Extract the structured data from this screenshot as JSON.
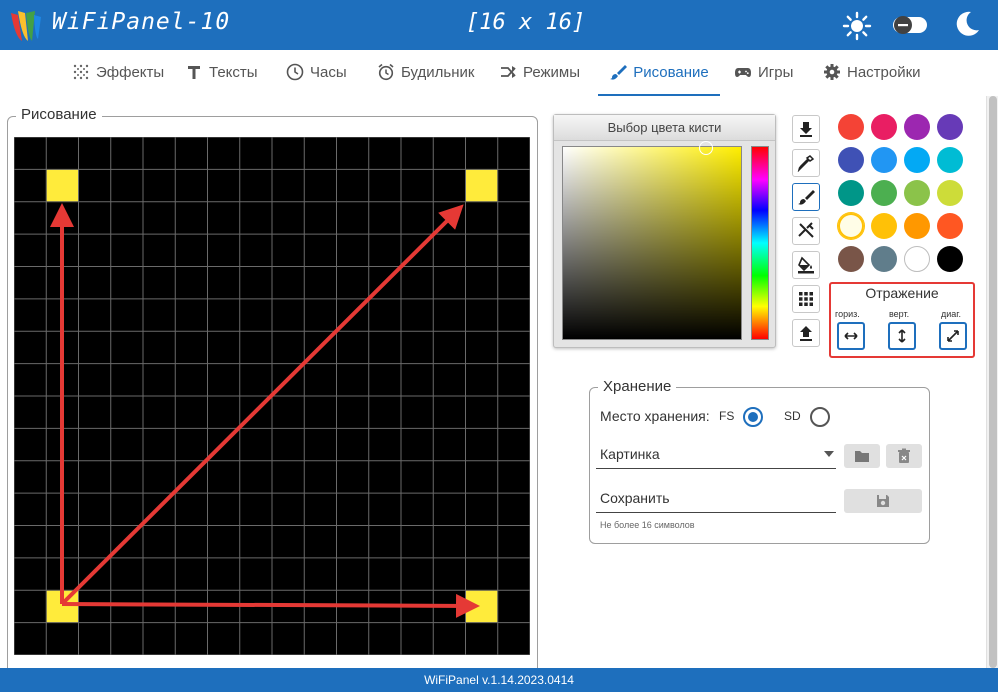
{
  "header": {
    "app_title": "WiFiPanel-10",
    "matrix_size": "[16 x 16]"
  },
  "tabs": [
    {
      "label": "Эффекты",
      "icon": "dots-grid-icon"
    },
    {
      "label": "Тексты",
      "icon": "text-icon"
    },
    {
      "label": "Часы",
      "icon": "clock-icon"
    },
    {
      "label": "Будильник",
      "icon": "alarm-icon"
    },
    {
      "label": "Режимы",
      "icon": "modes-icon"
    },
    {
      "label": "Рисование",
      "icon": "brush-icon",
      "active": true
    },
    {
      "label": "Игры",
      "icon": "gamepad-icon"
    },
    {
      "label": "Настройки",
      "icon": "gear-icon"
    }
  ],
  "drawing": {
    "legend": "Рисование",
    "grid_cols": 16,
    "grid_rows": 16,
    "lit_pixels": [
      {
        "col": 1,
        "row": 1,
        "color": "#ffeb3b"
      },
      {
        "col": 14,
        "row": 1,
        "color": "#ffeb3b"
      },
      {
        "col": 1,
        "row": 14,
        "color": "#ffeb3b"
      },
      {
        "col": 14,
        "row": 14,
        "color": "#ffeb3b"
      }
    ],
    "arrow_color": "#e53935"
  },
  "color_picker": {
    "title": "Выбор цвета кисти",
    "hue": "#ffee00"
  },
  "tools": [
    {
      "name": "download-icon",
      "selected": false
    },
    {
      "name": "eyedropper-icon",
      "selected": false
    },
    {
      "name": "brush-icon",
      "selected": true
    },
    {
      "name": "eraser-icon",
      "selected": false
    },
    {
      "name": "fill-bucket-icon",
      "selected": false
    },
    {
      "name": "grid-icon",
      "selected": false
    },
    {
      "name": "upload-icon",
      "selected": false
    }
  ],
  "palette": [
    "#f44336",
    "#e91e63",
    "#9c27b0",
    "#673ab7",
    "#3f51b5",
    "#2196f3",
    "#03a9f4",
    "#00bcd4",
    "#009688",
    "#4caf50",
    "#8bc34a",
    "#cddc39",
    "#fff9c4",
    "#ffc107",
    "#ff9800",
    "#ff5722",
    "#795548",
    "#607d8b",
    "#ffffff",
    "#000000"
  ],
  "palette_selected_index": 12,
  "mirror": {
    "title": "Отражение",
    "horizontal": "гориз.",
    "vertical": "верт.",
    "diagonal": "диаг."
  },
  "storage": {
    "legend": "Хранение",
    "place_label": "Место хранения:",
    "fs_label": "FS",
    "sd_label": "SD",
    "selected": "FS",
    "picture_value": "Картинка",
    "save_value": "Сохранить",
    "save_hint": "Не более 16 символов"
  },
  "footer": {
    "version": "WiFiPanel v.1.14.2023.0414"
  },
  "colors": {
    "accent": "#1e6fbd",
    "highlight": "#e53935"
  }
}
